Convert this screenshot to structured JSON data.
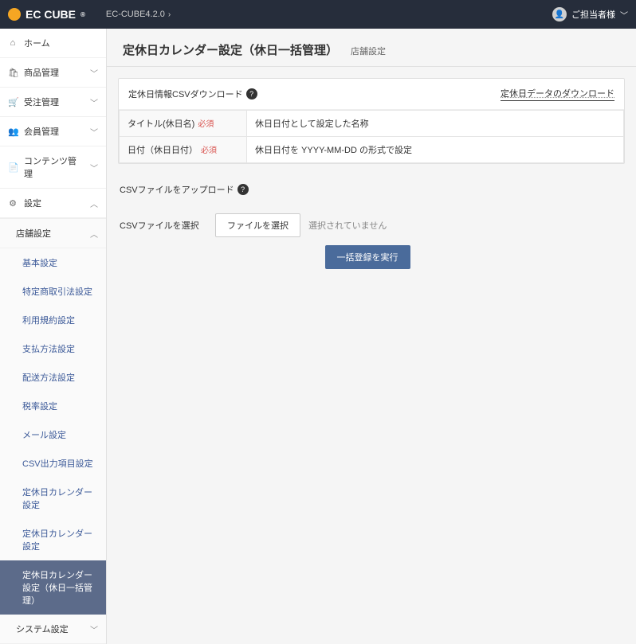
{
  "topbar": {
    "brand": "EC CUBE",
    "version": "EC-CUBE4.2.0",
    "user_label": "ご担当者様"
  },
  "sidebar": {
    "items": [
      {
        "icon": "⌂",
        "label": "ホーム"
      },
      {
        "icon": "🛍",
        "label": "商品管理"
      },
      {
        "icon": "🛒",
        "label": "受注管理"
      },
      {
        "icon": "👥",
        "label": "会員管理"
      },
      {
        "icon": "📄",
        "label": "コンテンツ管理"
      },
      {
        "icon": "⚙",
        "label": "設定"
      }
    ],
    "shop_group": {
      "head": "店舗設定",
      "items": [
        "基本設定",
        "特定商取引法設定",
        "利用規約設定",
        "支払方法設定",
        "配送方法設定",
        "税率設定",
        "メール設定",
        "CSV出力項目設定",
        "定休日カレンダー設定",
        "定休日カレンダー設定",
        "定休日カレンダー設定（休日一括管理）"
      ]
    },
    "system_group": {
      "head": "システム設定"
    }
  },
  "page": {
    "title": "定休日カレンダー設定（休日一括管理）",
    "sub": "店舗設定"
  },
  "panel1": {
    "head": "定休日情報CSVダウンロード",
    "download_link": "定休日データのダウンロード",
    "row1_label": "タイトル(休日名)",
    "row1_req": "必須",
    "row1_value": "休日日付として設定した名称",
    "row2_label": "日付（休日日付）",
    "row2_req": "必須",
    "row2_value": "休日日付を YYYY-MM-DD の形式で設定"
  },
  "panel2": {
    "head": "CSVファイルをアップロード",
    "row_label": "CSVファイルを選択",
    "file_btn": "ファイルを選択",
    "file_status": "選択されていません",
    "submit": "一括登録を実行"
  }
}
